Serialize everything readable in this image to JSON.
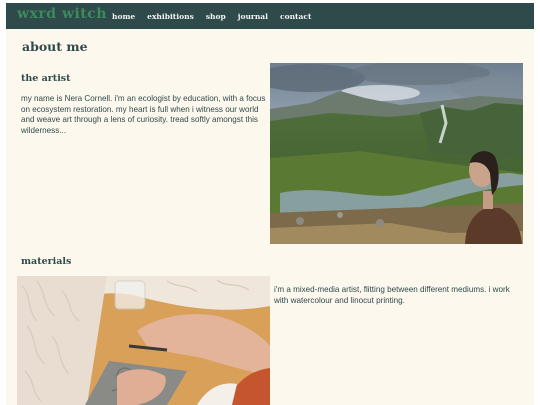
{
  "site": {
    "logo": "wxrd witch",
    "nav": [
      "home",
      "exhibitions",
      "shop",
      "journal",
      "contact"
    ]
  },
  "page_title": "about me",
  "artist": {
    "heading": "the artist",
    "text": "my name is Nera Cornell. i'm an ecologist by education, with a focus on ecosystem restoration. my heart is full when i witness our world and weave art through a lens of curiosity. tread softly amongst this wilderness..."
  },
  "materials": {
    "heading": "materials",
    "text": "i'm a mixed-media artist, flitting between different mediums. i work with watercolour and linocut printing."
  },
  "colors": {
    "nav_bg": "#2e4a4b",
    "logo": "#3d8a5a",
    "page_bg": "#fdf8ee",
    "heading": "#2e4a4b"
  }
}
